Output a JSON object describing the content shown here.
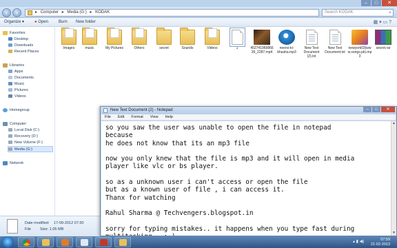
{
  "explorer": {
    "address": [
      "Computer",
      "Media (G:)",
      "KODAK"
    ],
    "search_placeholder": "Search KODAK",
    "toolbar": {
      "organize": "Organize ▾",
      "open": "Open",
      "burn": "Burn",
      "new_folder": "New folder"
    },
    "nav": {
      "favorites": "Favorites",
      "fav_items": [
        "Desktop",
        "Downloads",
        "Recent Places"
      ],
      "libraries": "Libraries",
      "lib_items": [
        "Apps",
        "Documents",
        "Music",
        "Pictures",
        "Videos"
      ],
      "homegroup": "Homegroup",
      "computer": "Computer",
      "comp_items": [
        "Local Disk (C:)",
        "Recovery (D:)",
        "New Volume (F:)",
        "Media (G:)"
      ],
      "network": "Network"
    },
    "items": [
      {
        "label": "Images",
        "kind": "folder"
      },
      {
        "label": "music",
        "kind": "folder"
      },
      {
        "label": "My Pictures",
        "kind": "folder"
      },
      {
        "label": "Others",
        "kind": "folder"
      },
      {
        "label": "secret",
        "kind": "folder"
      },
      {
        "label": "Sounds",
        "kind": "folder"
      },
      {
        "label": "Videos",
        "kind": "folder"
      },
      {
        "label": "1",
        "kind": "doc"
      },
      {
        "label": "45274196986639_2287.mp4",
        "kind": "video"
      },
      {
        "label": "neeno-ki-bhasha.mp3",
        "kind": "audio"
      },
      {
        "label": "New Text Document (2).txt",
        "kind": "txt"
      },
      {
        "label": "New Text Document.txt",
        "kind": "txt"
      },
      {
        "label": "newyork03(www.songs.pk).mp3",
        "kind": "winamp"
      },
      {
        "label": "secret.rar",
        "kind": "rar"
      }
    ],
    "details": {
      "date_label": "Date modified:",
      "date_value": "17-09-2012 07:30",
      "size_label": "Size:",
      "size_value": "1.05 MB",
      "type_label": "File"
    }
  },
  "notepad": {
    "title": "New Text Document (2) - Notepad",
    "menu": [
      "File",
      "Edit",
      "Format",
      "View",
      "Help"
    ],
    "text": "so you saw the user was unable to open the file in notepad\nbecause\nhe does not know that its an mp3 file\n\nnow you only knew that the file is mp3 and it will open in media\nplayer like vlc or bs player.\n\nso as a unknown user i can't access or open the file\nbut as a known user of file , i can access it.\nThanx for watching\n\nRahul Sharma @ Techvengers.blogspot.in\n\nsorry for typing mistakes.. it happens when you type fast during\nmultitasking ..:-)"
  },
  "taskbar": {
    "time": "07:59",
    "date": "21-02-2013"
  }
}
